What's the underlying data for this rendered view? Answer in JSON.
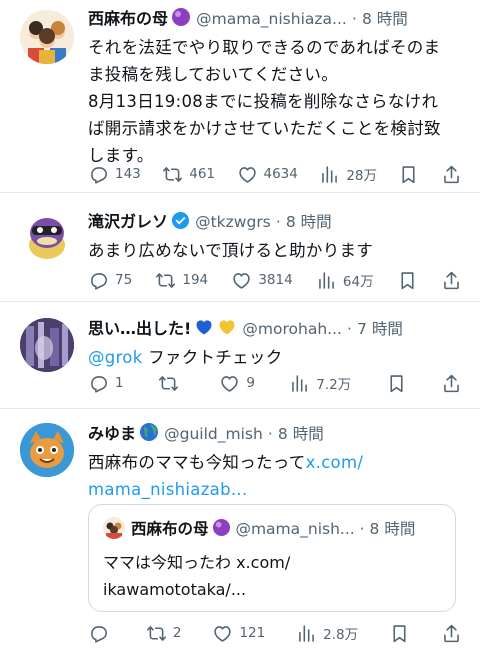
{
  "posts": [
    {
      "name": "西麻布の母",
      "handle": "@mama_nishiaza...",
      "time": "8 時間",
      "lines": [
        "それを法廷でやり取りできるのであればそのま",
        "ま投稿を残しておいてください。",
        "8月13日19:08までに投稿を削除なさらなけれ",
        "ば開示請求をかけさせていただくことを検討致",
        "します。"
      ],
      "replies": "143",
      "reposts": "461",
      "likes": "4634",
      "views": "28万"
    },
    {
      "name": "滝沢ガレソ",
      "handle": "@tkzwgrs",
      "time": "8 時間",
      "lines": [
        "あまり広めないで頂けると助かります"
      ],
      "replies": "75",
      "reposts": "194",
      "likes": "3814",
      "views": "64万"
    },
    {
      "name": "思い…出した!",
      "handle": "@morohah...",
      "time": "7 時間",
      "mention": "@grok",
      "text_after_mention": "ファクトチェック",
      "replies": "1",
      "reposts": "",
      "likes": "9",
      "views": "7.2万"
    },
    {
      "name": "みゆま",
      "handle": "@guild_mish",
      "time": "8 時間",
      "text_prefix": "西麻布のママも今知ったって",
      "link_part1": "x.com/",
      "link_part2": "mama_nishiazab...",
      "quote": {
        "name": "西麻布の母",
        "handle": "@mama_nish...",
        "time": "8 時間",
        "line1": "ママは今知ったわ x.com/",
        "line2": "ikawamototaka/..."
      },
      "replies": "",
      "reposts": "2",
      "likes": "121",
      "views": "2.8万"
    }
  ],
  "separator": "·",
  "colors": {
    "link": "#1d9bf0",
    "muted": "#536471",
    "verified": "#1d9bf0",
    "divider": "#e6e9ec"
  },
  "icons": [
    "reply-icon",
    "repost-icon",
    "like-icon",
    "views-icon",
    "bookmark-icon",
    "share-icon",
    "verified-badge-icon",
    "purple-orb-emoji",
    "globe-emoji",
    "blue-heart-emoji",
    "yellow-heart-emoji"
  ]
}
